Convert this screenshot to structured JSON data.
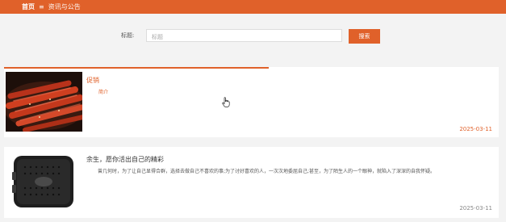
{
  "breadcrumb": {
    "home": "首页",
    "separator": "≡",
    "current": "资讯与公告"
  },
  "search": {
    "label": "标题:",
    "placeholder": "标题",
    "button_label": "搜索"
  },
  "articles": [
    {
      "title": "促销",
      "summary": "简介",
      "date": "2025-03-11",
      "image": "beef-jerky-photo"
    },
    {
      "title": "余生，愿你活出自己的精彩",
      "summary": "曾几何时，为了让自己显得合群，选择去做自己不喜欢的事;为了讨好喜欢的人，一次次地委屈自己;甚至，为了陌生人的一个眼神，就陷入了深深的自我怀疑。",
      "date": "2025-03-11",
      "image": "speaker-photo"
    }
  ],
  "colors": {
    "accent": "#e0612a"
  }
}
